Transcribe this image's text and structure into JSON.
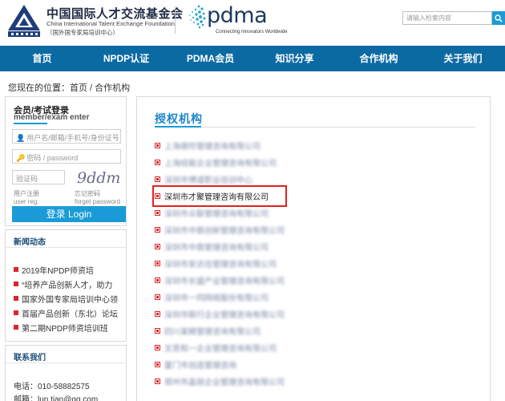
{
  "header": {
    "org_cn": "中国国际人才交流基金会",
    "org_en": "China International Talent Exchange Foundation",
    "org_sub": "（国外国专家局培训中心）",
    "brand": "pdma",
    "brand_tagline": "Connecting Innovators Worldwide",
    "search_placeholder": "请输入检索内容"
  },
  "nav": {
    "items": [
      "首页",
      "NPDP认证",
      "PDMA会员",
      "知识分享",
      "合作机构",
      "关于我们"
    ]
  },
  "breadcrumb": "您现在的位置：首页 / 合作机构",
  "login": {
    "title": "会员/考试登录",
    "subtitle": "member/exam enter",
    "username_placeholder": "用户名/邮箱/手机号/身份证号",
    "password_placeholder": "密码 / password",
    "captcha_placeholder": "验证码",
    "captcha_text": "9ddm",
    "register_cn": "用户注册",
    "register_en": "user reg.",
    "forgot_cn": "忘记密码",
    "forgot_en": "forget password",
    "login_button": "登录 Login"
  },
  "news": {
    "heading": "新闻动态",
    "items": [
      "2019年NPDP师资培",
      "“培养产品创新人才，助力",
      "国家外国专家局培训中心领",
      "首届产品创新（东北）论坛",
      "第二期NPDP师资培训班"
    ]
  },
  "contact": {
    "heading": "联系我们",
    "phone": "电话：010-58882575",
    "email": "邮箱：lun.tian@qq.com"
  },
  "main": {
    "title": "授权机构",
    "items": [
      "上海德符管理咨询有限公司",
      "上海经能企业管理咨询有限公司",
      "深圳市博道职业培训中心",
      "深圳市才聚管理咨询有限公司",
      "深圳市众联管理咨询有限公司",
      "深圳市中鼎创新管理咨询有限公司",
      "深圳市中鼎管理咨询有限公司",
      "深圳市安达信管理咨询有限公司",
      "深圳市长盛产业管理咨询有限公司",
      "深圳市一同网络股份有限公司",
      "深圳市联行企业管理咨询有限公司",
      "四川某精管理咨询有限公司",
      "文思和一企业管理咨询有限公司",
      "厦门市创造管理咨询",
      "郑州市晶锐企业管理咨询有限公司"
    ],
    "highlighted_index": 3
  }
}
